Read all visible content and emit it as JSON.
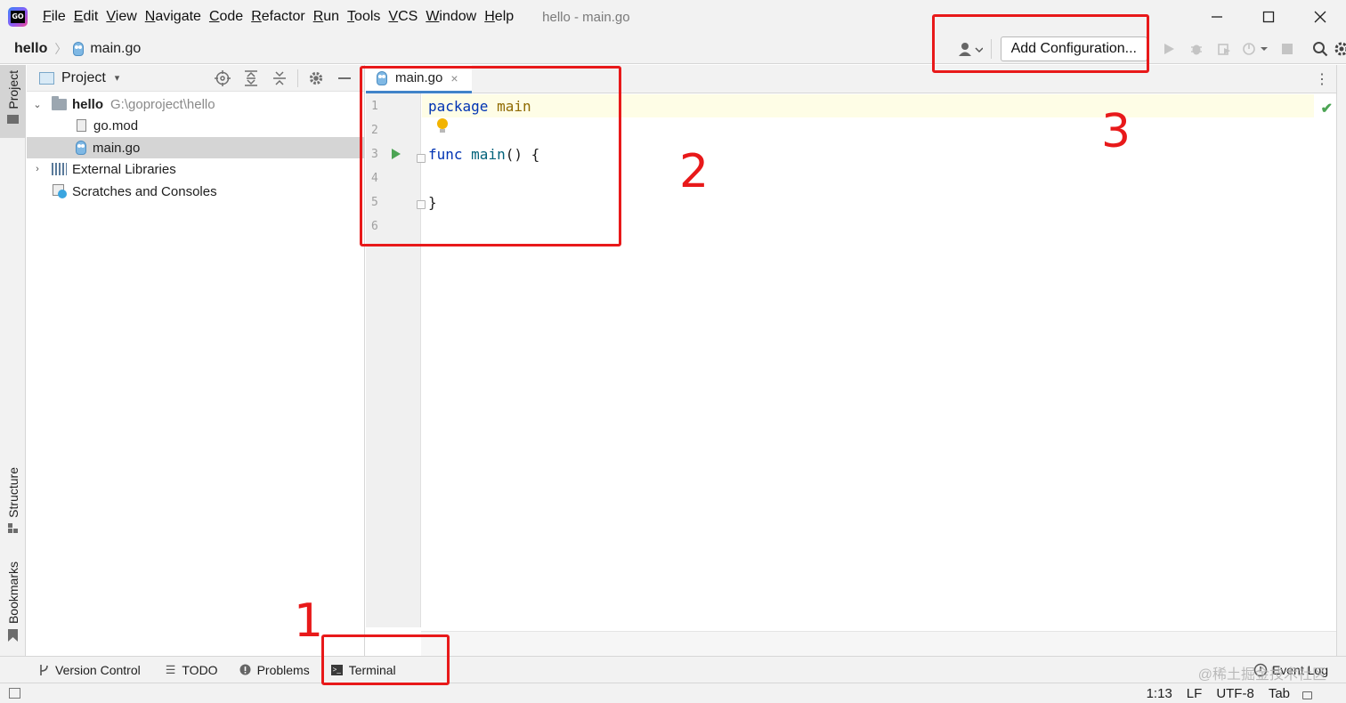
{
  "app": {
    "window_title": "hello - main.go"
  },
  "menu": [
    "File",
    "Edit",
    "View",
    "Navigate",
    "Code",
    "Refactor",
    "Run",
    "Tools",
    "VCS",
    "Window",
    "Help"
  ],
  "navbar": {
    "project": "hello",
    "separator": "〉",
    "file": "main.go",
    "add_configuration": "Add Configuration..."
  },
  "left_stripe": {
    "project": "Project",
    "structure": "Structure",
    "bookmarks": "Bookmarks"
  },
  "project_panel": {
    "title": "Project",
    "dropdown": "▾",
    "tree": [
      {
        "label": "hello",
        "path": "G:\\goproject\\hello",
        "chevron": "⌄"
      },
      {
        "label": "go.mod"
      },
      {
        "label": "main.go",
        "selected": true
      },
      {
        "label": "External Libraries",
        "chevron": "›"
      },
      {
        "label": "Scratches and Consoles"
      }
    ]
  },
  "editor": {
    "tab_label": "main.go",
    "tab_close": "×",
    "more": "⋮",
    "line_numbers": [
      "1",
      "2",
      "3",
      "4",
      "5",
      "6"
    ],
    "code": {
      "l1_kw": "package",
      "l1_name": "main",
      "l3_kw": "func",
      "l3_name": "main",
      "l3_rest": "() {",
      "l5": "}"
    },
    "inspection_ok": "✔"
  },
  "bottom_tools": {
    "version_control": "Version Control",
    "todo": "TODO",
    "problems": "Problems",
    "terminal": "Terminal",
    "event_log": "Event Log"
  },
  "watermark": "@稀土掘金技术社区",
  "status": {
    "position": "1:13",
    "line_sep": "LF",
    "encoding": "UTF-8",
    "indent": "Tab"
  },
  "annotations": [
    "1",
    "2",
    "3"
  ],
  "colors": {
    "annotation_red": "#e8191a",
    "tab_underline": "#4083c9",
    "keyword": "#0033b3",
    "run_green": "#4ca454"
  }
}
